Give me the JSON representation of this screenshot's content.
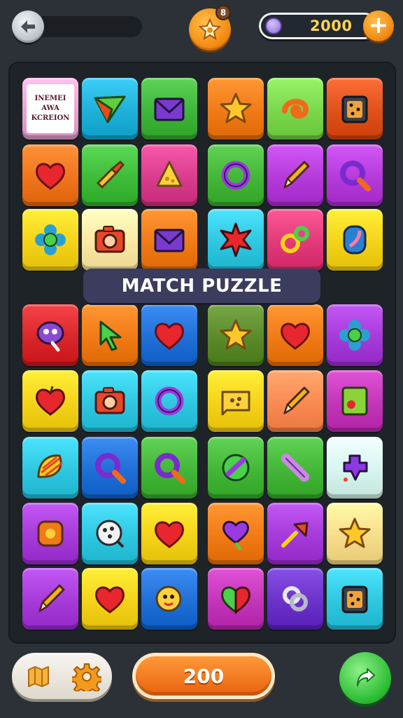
{
  "header": {
    "back_icon": "back-arrow-icon",
    "booster_icon": "star-badge-icon",
    "booster_badge": "8",
    "coins_icon": "gem-icon",
    "coins_value": "2000",
    "add_coins_label": "+"
  },
  "board": {
    "title": "MATCH PUZZLE",
    "text_tile_lines": [
      "INEMEI",
      "AWA",
      "KCREION"
    ],
    "rows": [
      [
        {
          "bg": "#e9a3d2",
          "icon": "text-card"
        },
        {
          "bg": "#1fb0d9",
          "icon": "paper-plane"
        },
        {
          "bg": "#3fb53a",
          "icon": "envelope"
        },
        {
          "bg": "#f07a16",
          "icon": "star"
        },
        {
          "bg": "#7ad64a",
          "icon": "swirl"
        },
        {
          "bg": "#e0501a",
          "icon": "dice-box"
        }
      ],
      [
        {
          "bg": "#f0741c",
          "icon": "heart"
        },
        {
          "bg": "#3fbb3a",
          "icon": "brush"
        },
        {
          "bg": "#d93c8c",
          "icon": "cheese"
        },
        {
          "bg": "#43b638",
          "icon": "ring"
        },
        {
          "bg": "#b43ad9",
          "icon": "pencil"
        },
        {
          "bg": "#b43ad9",
          "icon": "magnifier"
        }
      ],
      [
        {
          "bg": "#f5d21a",
          "icon": "flower"
        },
        {
          "bg": "#fbe8a3",
          "icon": "camera"
        },
        {
          "bg": "#f07a16",
          "icon": "envelope"
        },
        {
          "bg": "#2fc6e0",
          "icon": "burst"
        },
        {
          "bg": "#e23a78",
          "icon": "key-ring"
        },
        {
          "bg": "#f5d21a",
          "icon": "gem"
        }
      ],
      [
        {
          "bg": "#d8262a",
          "icon": "blob-face"
        },
        {
          "bg": "#f07a16",
          "icon": "arrow-cursor"
        },
        {
          "bg": "#1f6fd6",
          "icon": "heart"
        },
        {
          "bg": "#5a8a2a",
          "icon": "star"
        },
        {
          "bg": "#f07a16",
          "icon": "heart"
        },
        {
          "bg": "#a53ad9",
          "icon": "flower"
        }
      ],
      [
        {
          "bg": "#f5d21a",
          "icon": "apple-heart"
        },
        {
          "bg": "#2fc6e0",
          "icon": "camera"
        },
        {
          "bg": "#2fc6e0",
          "icon": "ring"
        },
        {
          "bg": "#f5d21a",
          "icon": "cheese-sign"
        },
        {
          "bg": "#fa8a52",
          "icon": "pencil"
        },
        {
          "bg": "#c235b8",
          "icon": "sticky-note"
        }
      ],
      [
        {
          "bg": "#2fc6e0",
          "icon": "shell"
        },
        {
          "bg": "#1f6fd6",
          "icon": "magnifier"
        },
        {
          "bg": "#43b638",
          "icon": "magnifier"
        },
        {
          "bg": "#43b638",
          "icon": "ball"
        },
        {
          "bg": "#43b638",
          "icon": "capsule"
        },
        {
          "bg": "#d6f5ee",
          "icon": "splat"
        }
      ],
      [
        {
          "bg": "#a53ad9",
          "icon": "flower-square"
        },
        {
          "bg": "#2fc6e0",
          "icon": "cookie"
        },
        {
          "bg": "#f5d21a",
          "icon": "heart"
        },
        {
          "bg": "#f07a16",
          "icon": "heart-lolly"
        },
        {
          "bg": "#a53ad9",
          "icon": "pin"
        },
        {
          "bg": "#f7dd8a",
          "icon": "star"
        }
      ],
      [
        {
          "bg": "#a53ad9",
          "icon": "pencil"
        },
        {
          "bg": "#f5d21a",
          "icon": "heart"
        },
        {
          "bg": "#1f6fd6",
          "icon": "cookie-face"
        },
        {
          "bg": "#c235b8",
          "icon": "heart-split"
        },
        {
          "bg": "#6a32c9",
          "icon": "knot"
        },
        {
          "bg": "#2fc6e0",
          "icon": "dice-box"
        }
      ]
    ]
  },
  "footer": {
    "map_icon": "map-icon",
    "settings_icon": "gear-icon",
    "play_value": "200",
    "share_icon": "share-arrow-icon"
  }
}
